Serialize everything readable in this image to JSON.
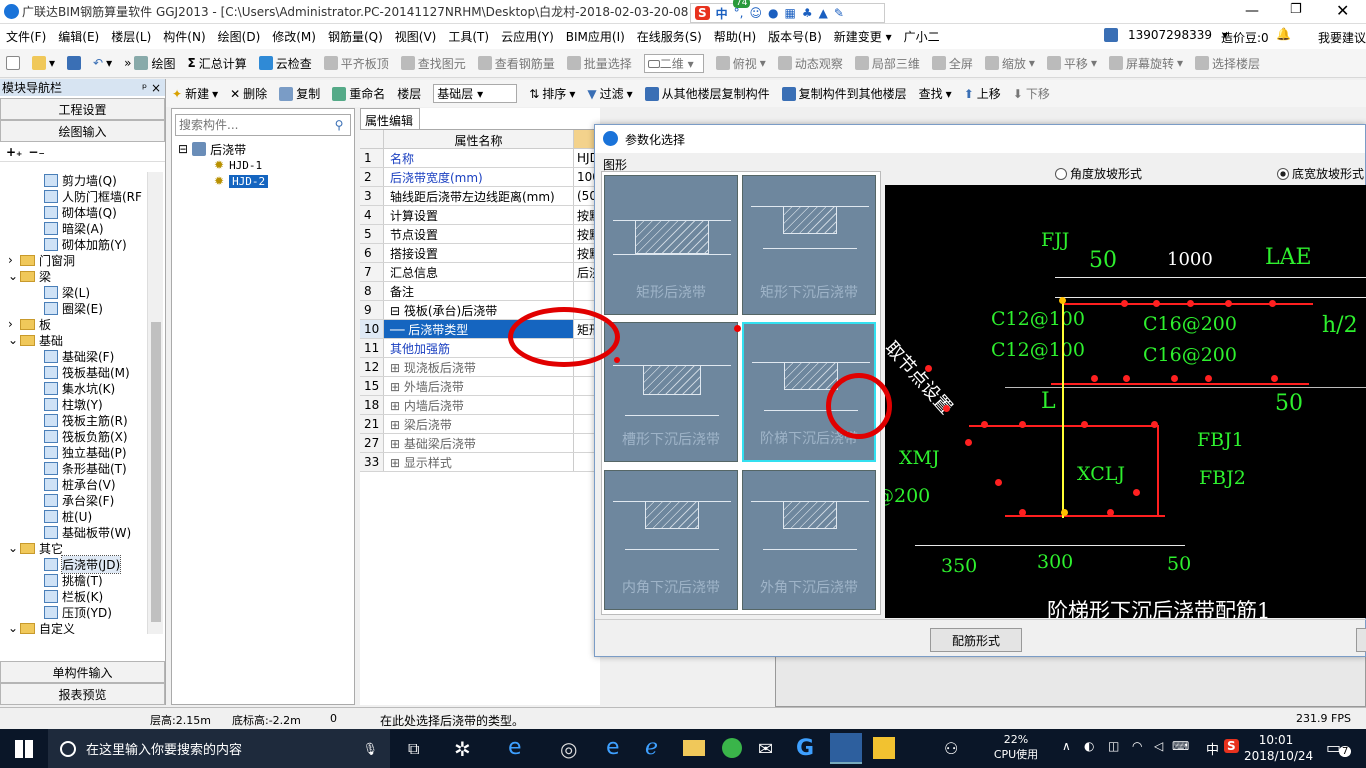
{
  "window": {
    "title": "广联达BIM钢筋算量软件 GGJ2013 - [C:\\Users\\Administrator.PC-20141127NRHM\\Desktop\\白龙村-2018-02-03-20-08"
  },
  "ime": {
    "label": "中",
    "badge": "74"
  },
  "menus": [
    "文件(F)",
    "编辑(E)",
    "楼层(L)",
    "构件(N)",
    "绘图(D)",
    "修改(M)",
    "钢筋量(Q)",
    "视图(V)",
    "工具(T)",
    "云应用(Y)",
    "BIM应用(I)",
    "在线服务(S)",
    "帮助(H)",
    "版本号(B)",
    "新建变更 ▾",
    "广小二"
  ],
  "account": {
    "phone": "13907298339",
    "coins": "造价豆:0",
    "suggest": "我要建议"
  },
  "toolbar1": {
    "draw": "绘图",
    "sum": "汇总计算",
    "cloud": "云检查",
    "flat": "平齐板顶",
    "find": "查找图元",
    "view_steel": "查看钢筋量",
    "batch": "批量选择",
    "dim": "二维",
    "top": "俯视",
    "dynamic": "动态观察",
    "local3d": "局部三维",
    "full": "全屏",
    "zoom": "缩放",
    "pan": "平移",
    "rotate": "屏幕旋转",
    "select_floor": "选择楼层"
  },
  "toolbar2": {
    "new": "新建",
    "del": "删除",
    "copy": "复制",
    "rename": "重命名",
    "floor": "楼层",
    "floor_val": "基础层",
    "sort": "排序",
    "filter": "过滤",
    "copy_from": "从其他楼层复制构件",
    "copy_to": "复制构件到其他楼层",
    "find": "查找",
    "up": "上移",
    "down": "下移"
  },
  "nav": {
    "title": "模块导航栏",
    "pin": "ᵖ ×",
    "project": "工程设置",
    "draw_input": "绘图输入",
    "single": "单构件输入",
    "report": "报表预览",
    "tree": [
      {
        "t": "剪力墙(Q)",
        "lvl": 3
      },
      {
        "t": "人防门框墙(RF",
        "lvl": 3
      },
      {
        "t": "砌体墙(Q)",
        "lvl": 3
      },
      {
        "t": "暗梁(A)",
        "lvl": 3
      },
      {
        "t": "砌体加筋(Y)",
        "lvl": 3
      },
      {
        "t": "门窗洞",
        "lvl": 1,
        "f": true
      },
      {
        "t": "梁",
        "lvl": 1,
        "f": true
      },
      {
        "t": "梁(L)",
        "lvl": 3
      },
      {
        "t": "圈梁(E)",
        "lvl": 3
      },
      {
        "t": "板",
        "lvl": 1,
        "f": true
      },
      {
        "t": "基础",
        "lvl": 1,
        "f": true
      },
      {
        "t": "基础梁(F)",
        "lvl": 3
      },
      {
        "t": "筏板基础(M)",
        "lvl": 3
      },
      {
        "t": "集水坑(K)",
        "lvl": 3
      },
      {
        "t": "柱墩(Y)",
        "lvl": 3
      },
      {
        "t": "筏板主筋(R)",
        "lvl": 3
      },
      {
        "t": "筏板负筋(X)",
        "lvl": 3
      },
      {
        "t": "独立基础(P)",
        "lvl": 3
      },
      {
        "t": "条形基础(T)",
        "lvl": 3
      },
      {
        "t": "桩承台(V)",
        "lvl": 3
      },
      {
        "t": "承台梁(F)",
        "lvl": 3
      },
      {
        "t": "桩(U)",
        "lvl": 3
      },
      {
        "t": "基础板带(W)",
        "lvl": 3
      },
      {
        "t": "其它",
        "lvl": 1,
        "f": true
      },
      {
        "t": "后浇带(JD)",
        "lvl": 3,
        "sel": true
      },
      {
        "t": "挑檐(T)",
        "lvl": 3
      },
      {
        "t": "栏板(K)",
        "lvl": 3
      },
      {
        "t": "压顶(YD)",
        "lvl": 3
      },
      {
        "t": "自定义",
        "lvl": 1,
        "f": true
      }
    ]
  },
  "comptree": {
    "search_placeholder": "搜索构件...",
    "root": "后浇带",
    "items": [
      "HJD-1",
      "HJD-2"
    ]
  },
  "props": {
    "tab": "属性编辑",
    "col": "属性名称",
    "rows": [
      {
        "n": "1",
        "k": "名称",
        "v": "HJD",
        "blue": true
      },
      {
        "n": "2",
        "k": "后浇带宽度(mm)",
        "v": "100",
        "blue": true
      },
      {
        "n": "3",
        "k": "轴线距后浇带左边线距离(mm)",
        "v": "(50"
      },
      {
        "n": "4",
        "k": "计算设置",
        "v": "按默"
      },
      {
        "n": "5",
        "k": "节点设置",
        "v": "按默"
      },
      {
        "n": "6",
        "k": "搭接设置",
        "v": "按默"
      },
      {
        "n": "7",
        "k": "汇总信息",
        "v": "后浇"
      },
      {
        "n": "8",
        "k": "备注",
        "v": ""
      },
      {
        "n": "9",
        "k": "⊟ 筏板(承台)后浇带",
        "v": ""
      },
      {
        "n": "10",
        "k": "── 后浇带类型",
        "v": "矩形",
        "sel": true
      },
      {
        "n": "11",
        "k": "    其他加强筋",
        "v": "",
        "blue": true
      },
      {
        "n": "12",
        "k": "⊞ 现浇板后浇带",
        "v": ""
      },
      {
        "n": "15",
        "k": "⊞ 外墙后浇带",
        "v": ""
      },
      {
        "n": "18",
        "k": "⊞ 内墙后浇带",
        "v": ""
      },
      {
        "n": "21",
        "k": "⊞ 梁后浇带",
        "v": ""
      },
      {
        "n": "27",
        "k": "⊞ 基础梁后浇带",
        "v": ""
      },
      {
        "n": "33",
        "k": "⊞ 显示样式",
        "v": ""
      }
    ]
  },
  "dialog": {
    "title": "参数化选择",
    "group": "图形",
    "radio1": "角度放坡形式",
    "radio2": "底宽放坡形式",
    "button": "配筋形式",
    "shapes": [
      "矩形后浇带",
      "矩形下沉后浇带",
      "槽形下沉后浇带",
      "阶梯下沉后浇带",
      "内角下沉后浇带",
      "外角下沉后浇带"
    ],
    "preview": {
      "fjj": "FJJ",
      "d50a": "50",
      "d1000": "1000",
      "lae": "LAE",
      "c12a": "C12@100",
      "c12b": "C12@100",
      "c16a": "C16@200",
      "c16b": "C16@200",
      "h2": "h/2",
      "qjd": "取节点设置",
      "L": "L",
      "d50b": "50",
      "fbj1": "FBJ1",
      "fbj2": "FBJ2",
      "xmj": "XMJ",
      "xclj": "XCLJ",
      "at200": "@200",
      "d350": "350",
      "d300": "300",
      "d50c": "50",
      "caption": "阶梯形下沉后浇带配筋1"
    }
  },
  "status": {
    "floor_h": "层高:2.15m",
    "base_h": "底标高:-2.2m",
    "zero": "0",
    "msg": "在此处选择后浇带的类型。",
    "fps": "231.9 FPS"
  },
  "taskbar": {
    "search": "在这里输入你要搜索的内容",
    "cpu": "22%",
    "cpu_label": "CPU使用",
    "lang": "中",
    "time": "10:01",
    "date": "2018/10/24",
    "notif": "7"
  }
}
